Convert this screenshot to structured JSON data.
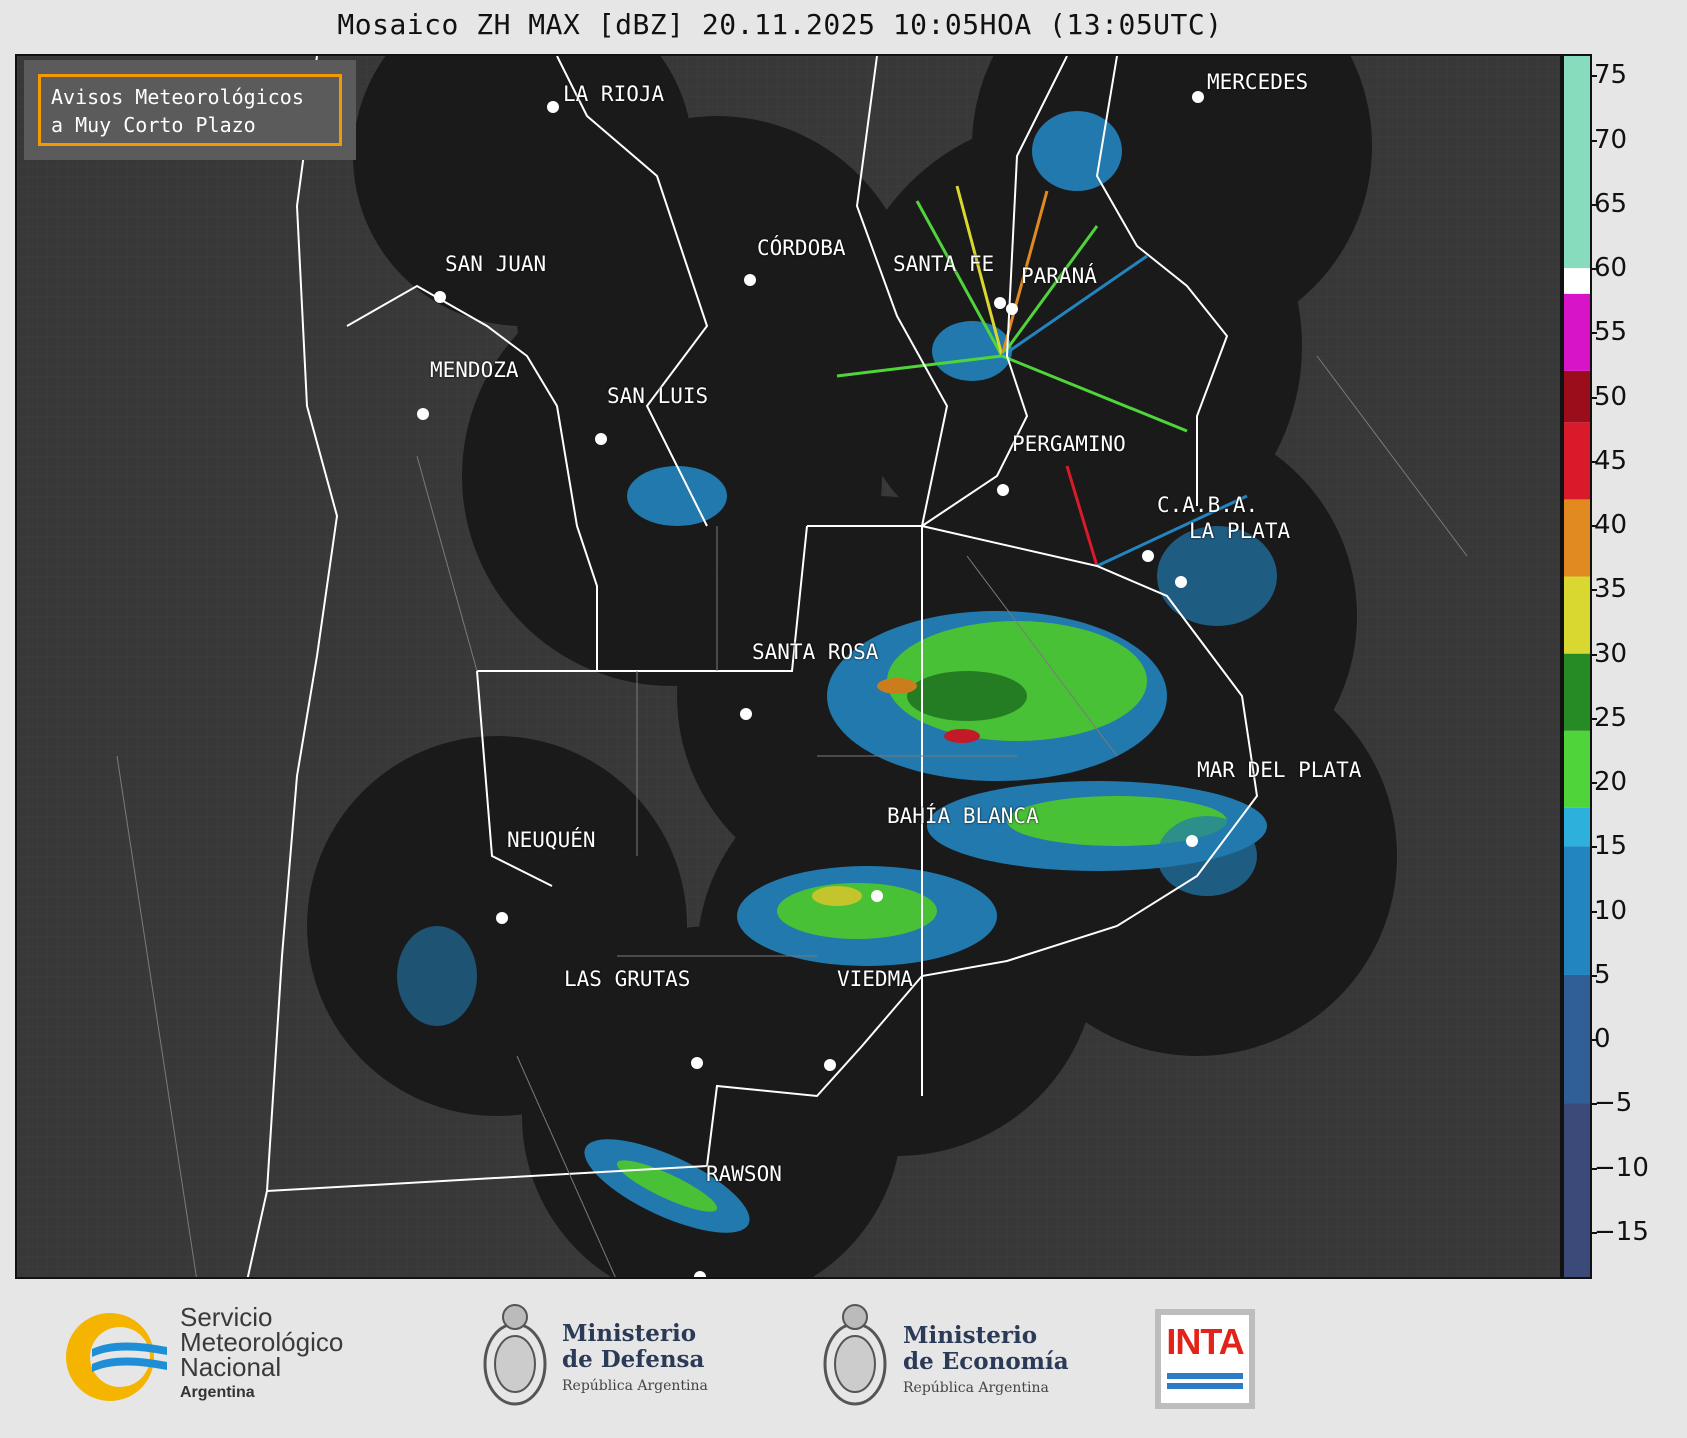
{
  "title": "Mosaico ZH MAX [dBZ] 20.11.2025 10:05HOA (13:05UTC)",
  "avisos": {
    "line1": "Avisos Meteorológicos",
    "line2": "a Muy Corto Plazo"
  },
  "cities": [
    {
      "name": "LA RIOJA"
    },
    {
      "name": "MERCEDES"
    },
    {
      "name": "CÓRDOBA"
    },
    {
      "name": "SAN JUAN"
    },
    {
      "name": "SANTA FE"
    },
    {
      "name": "PARANÁ"
    },
    {
      "name": "MENDOZA"
    },
    {
      "name": "SAN LUIS"
    },
    {
      "name": "PERGAMINO"
    },
    {
      "name": "C.A.B.A."
    },
    {
      "name": "LA PLATA"
    },
    {
      "name": "SANTA ROSA"
    },
    {
      "name": "MAR DEL PLATA"
    },
    {
      "name": "BAHÍA BLANCA"
    },
    {
      "name": "NEUQUÉN"
    },
    {
      "name": "LAS GRUTAS"
    },
    {
      "name": "VIEDMA"
    },
    {
      "name": "RAWSON"
    }
  ],
  "colorbar": {
    "unit": "dBZ",
    "range": [
      -18.5,
      76.5
    ],
    "ticks": [
      "75",
      "70",
      "65",
      "60",
      "55",
      "50",
      "45",
      "40",
      "35",
      "30",
      "25",
      "20",
      "15",
      "10",
      "5",
      "0",
      "−5",
      "−10",
      "−15"
    ],
    "tick_values": [
      75,
      70,
      65,
      60,
      55,
      50,
      45,
      40,
      35,
      30,
      25,
      20,
      15,
      10,
      5,
      0,
      -5,
      -10,
      -15
    ],
    "stops": [
      {
        "from": -18.5,
        "to": -5,
        "color": "#3c4a7a"
      },
      {
        "from": -5,
        "to": 5,
        "color": "#2f5f96"
      },
      {
        "from": 5,
        "to": 15,
        "color": "#2385bf"
      },
      {
        "from": 15,
        "to": 18,
        "color": "#2eb0dc"
      },
      {
        "from": 18,
        "to": 24,
        "color": "#4fd53a"
      },
      {
        "from": 24,
        "to": 30,
        "color": "#268a25"
      },
      {
        "from": 30,
        "to": 36,
        "color": "#d8d830"
      },
      {
        "from": 36,
        "to": 42,
        "color": "#e08a20"
      },
      {
        "from": 42,
        "to": 48,
        "color": "#d81a2a"
      },
      {
        "from": 48,
        "to": 52,
        "color": "#9b0d1a"
      },
      {
        "from": 52,
        "to": 58,
        "color": "#d814c8"
      },
      {
        "from": 58,
        "to": 60,
        "color": "#ffffff"
      },
      {
        "from": 60,
        "to": 76.5,
        "color": "#86dcbc"
      }
    ]
  },
  "logos": {
    "smn": {
      "line1": "Servicio",
      "line2": "Meteorológico",
      "line3": "Nacional",
      "country": "Argentina"
    },
    "defensa": {
      "line1": "Ministerio",
      "line2": "de Defensa",
      "sub": "República Argentina"
    },
    "economia": {
      "line1": "Ministerio",
      "line2": "de Economía",
      "sub": "República Argentina"
    },
    "inta": {
      "text": "INTA"
    }
  }
}
